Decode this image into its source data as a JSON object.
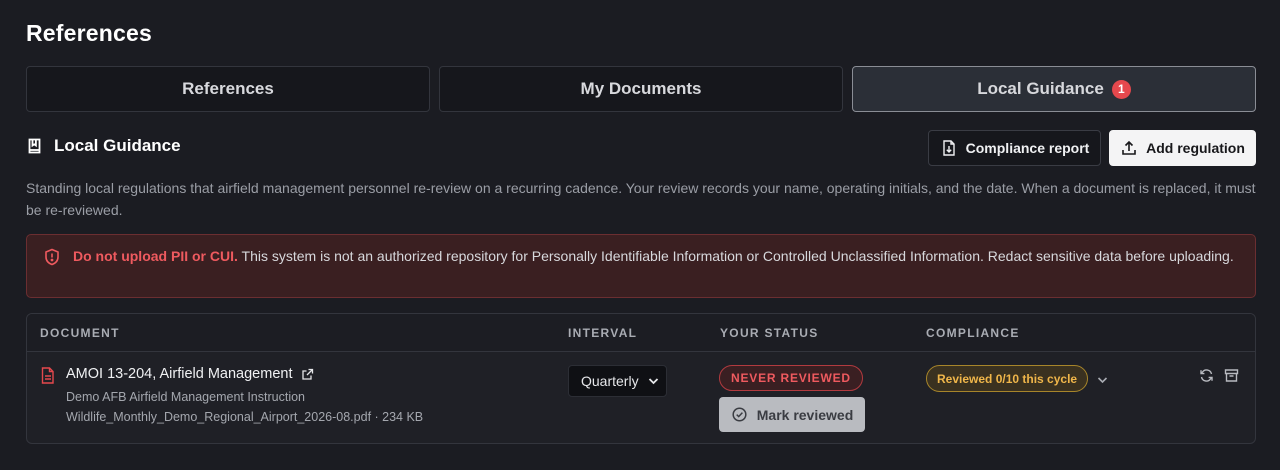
{
  "page": {
    "title": "References"
  },
  "tabs": [
    {
      "label": "References",
      "active": false
    },
    {
      "label": "My Documents",
      "active": false
    },
    {
      "label": "Local Guidance",
      "active": true,
      "badge": "1"
    }
  ],
  "section": {
    "title": "Local Guidance",
    "icon": "book-icon",
    "compliance_button": "Compliance report",
    "add_button": "Add regulation",
    "description": "Standing local regulations that airfield management personnel re-review on a recurring cadence. Your review records your name, operating initials, and the date. When a document is replaced, it must be re-reviewed."
  },
  "alert": {
    "strong": "Do not upload PII or CUI.",
    "text": " This system is not an authorized repository for Personally Identifiable Information or Controlled Unclassified Information. Redact sensitive data before uploading."
  },
  "table": {
    "headers": {
      "document": "DOCUMENT",
      "interval": "INTERVAL",
      "status": "YOUR STATUS",
      "compliance": "COMPLIANCE"
    },
    "rows": [
      {
        "title": "AMOI 13-204, Airfield Management",
        "subtitle": "Demo AFB Airfield Management Instruction",
        "file": "Wildlife_Monthly_Demo_Regional_Airport_2026-08.pdf · 234 KB",
        "interval": "Quarterly",
        "status": "NEVER REVIEWED",
        "mark_button": "Mark reviewed",
        "compliance": "Reviewed 0/10 this cycle"
      }
    ]
  },
  "colors": {
    "background": "#1b1c22",
    "danger": "#ef5a5f",
    "warning": "#f0b64a",
    "badge": "#e5484d"
  }
}
